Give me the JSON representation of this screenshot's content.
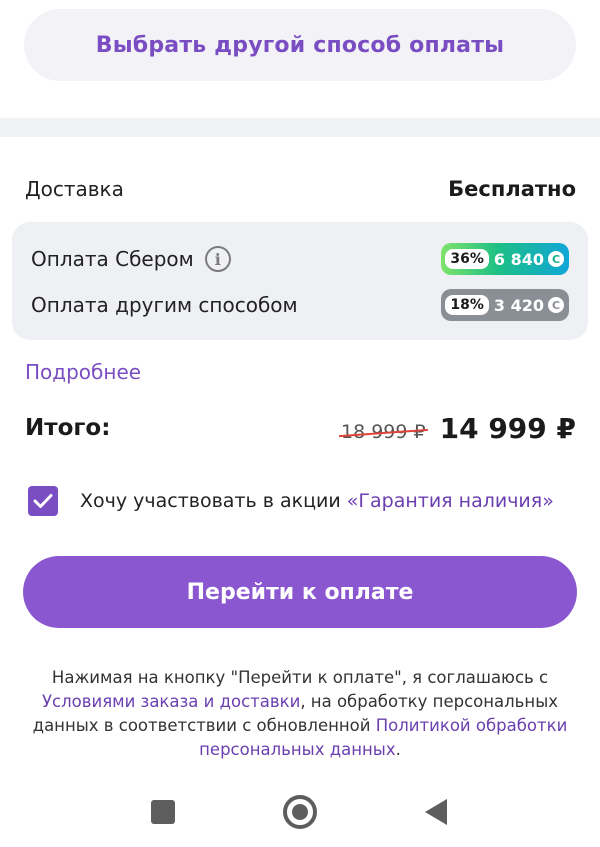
{
  "alt_payment": {
    "label": "Выбрать другой способ оплаты"
  },
  "delivery": {
    "label": "Доставка",
    "value": "Бесплатно"
  },
  "bonuses": {
    "sber": {
      "label": "Оплата Сбером",
      "percent": "36%",
      "amount": "6 840",
      "coin": "С",
      "icon": "info-icon"
    },
    "other": {
      "label": "Оплата другим способом",
      "percent": "18%",
      "amount": "3 420",
      "coin": "С"
    }
  },
  "more_link": "Подробнее",
  "total": {
    "label": "Итого:",
    "old_price": "18 999 ₽",
    "new_price": "14 999 ₽"
  },
  "promo": {
    "checked": true,
    "text": "Хочу участвовать в акции ",
    "link": "«Гарантия наличия»"
  },
  "pay_button": {
    "label": "Перейти к оплате"
  },
  "legal": {
    "part1": "Нажимая на кнопку \"Перейти к оплате\", я соглашаюсь с ",
    "link1": "Условиями заказа и доставки",
    "part2": ", на обработку персональных данных в соответствии с обновленной ",
    "link2": "Политикой обработки персональных данных",
    "part3": "."
  },
  "colors": {
    "accent": "#8a57d1",
    "accent_text": "#7a4ec2",
    "old_price_strike": "#e0423a"
  },
  "navbar": {
    "icons": [
      "recents-square-icon",
      "home-circle-icon",
      "back-triangle-icon"
    ]
  }
}
